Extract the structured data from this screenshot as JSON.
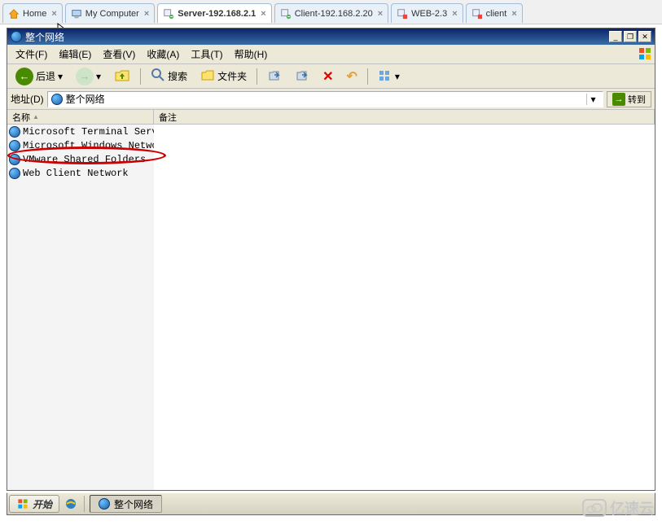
{
  "tabs": [
    {
      "label": "Home"
    },
    {
      "label": "My Computer"
    },
    {
      "label": "Server-192.168.2.1"
    },
    {
      "label": "Client-192.168.2.20"
    },
    {
      "label": "WEB-2.3"
    },
    {
      "label": "client"
    }
  ],
  "window": {
    "title": "整个网络"
  },
  "menus": {
    "file": "文件(F)",
    "edit": "编辑(E)",
    "view": "查看(V)",
    "favorites": "收藏(A)",
    "tools": "工具(T)",
    "help": "帮助(H)"
  },
  "toolbar": {
    "back": "后退",
    "search": "搜索",
    "folders": "文件夹"
  },
  "addressbar": {
    "label": "地址(D)",
    "value": "整个网络",
    "go": "转到"
  },
  "columns": {
    "name": "名称",
    "comment": "备注"
  },
  "items": [
    {
      "label": "Microsoft Terminal Serv..."
    },
    {
      "label": "Microsoft Windows Network"
    },
    {
      "label": "VMware Shared Folders"
    },
    {
      "label": "Web Client Network"
    }
  ],
  "taskbar": {
    "start": "开始",
    "active_task": "整个网络"
  },
  "watermark": "亿速云"
}
